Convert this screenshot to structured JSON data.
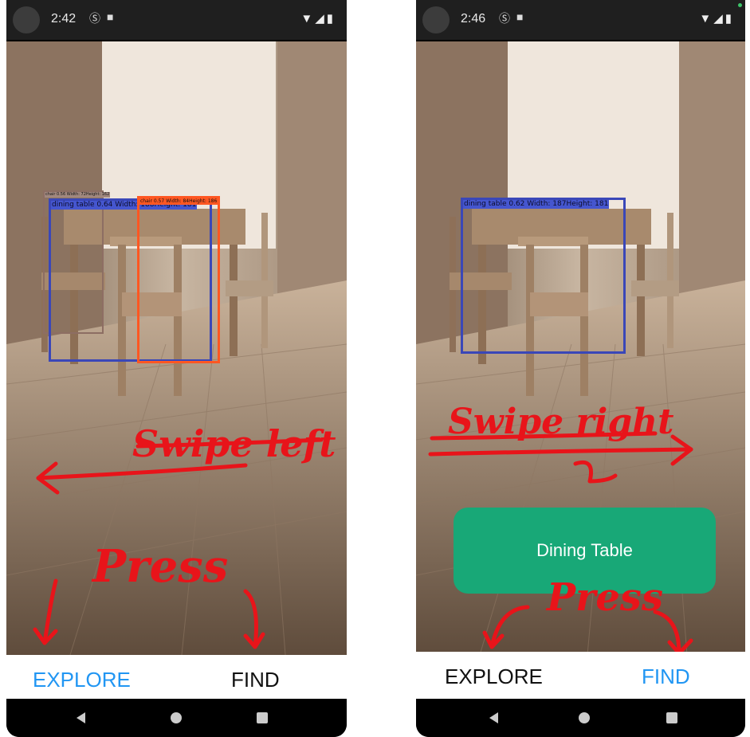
{
  "left_screen": {
    "status": {
      "time": "2:42"
    },
    "detections": [
      {
        "label": "dining table 0.64 Width: 188Height: 181"
      },
      {
        "label": "chair 0.57 Width: 84Height: 186"
      },
      {
        "label": "chair 0.56 Width: 72Height: 162"
      }
    ],
    "annotations": {
      "swipe": "Swipe left",
      "press": "Press"
    },
    "tabs": {
      "explore": "EXPLORE",
      "find": "FIND"
    },
    "active_tab": "explore"
  },
  "right_screen": {
    "status": {
      "time": "2:46"
    },
    "detections": [
      {
        "label": "dining table 0.62 Width: 187Height: 181"
      }
    ],
    "annotations": {
      "swipe": "Swipe right",
      "press": "Press"
    },
    "result_card": {
      "text": "Dining Table"
    },
    "tabs": {
      "explore": "EXPLORE",
      "find": "FIND"
    },
    "active_tab": "find"
  },
  "colors": {
    "active_tab": "#2196f3",
    "result_card": "#18a877",
    "annotation_red": "#e8141a",
    "bbox_blue": "#3a47b8",
    "bbox_orange": "#ff5722"
  },
  "icons": [
    "back-icon",
    "home-icon",
    "recents-icon",
    "wifi-icon",
    "signal-icon",
    "battery-icon",
    "sim-icon",
    "sd-card-icon"
  ]
}
